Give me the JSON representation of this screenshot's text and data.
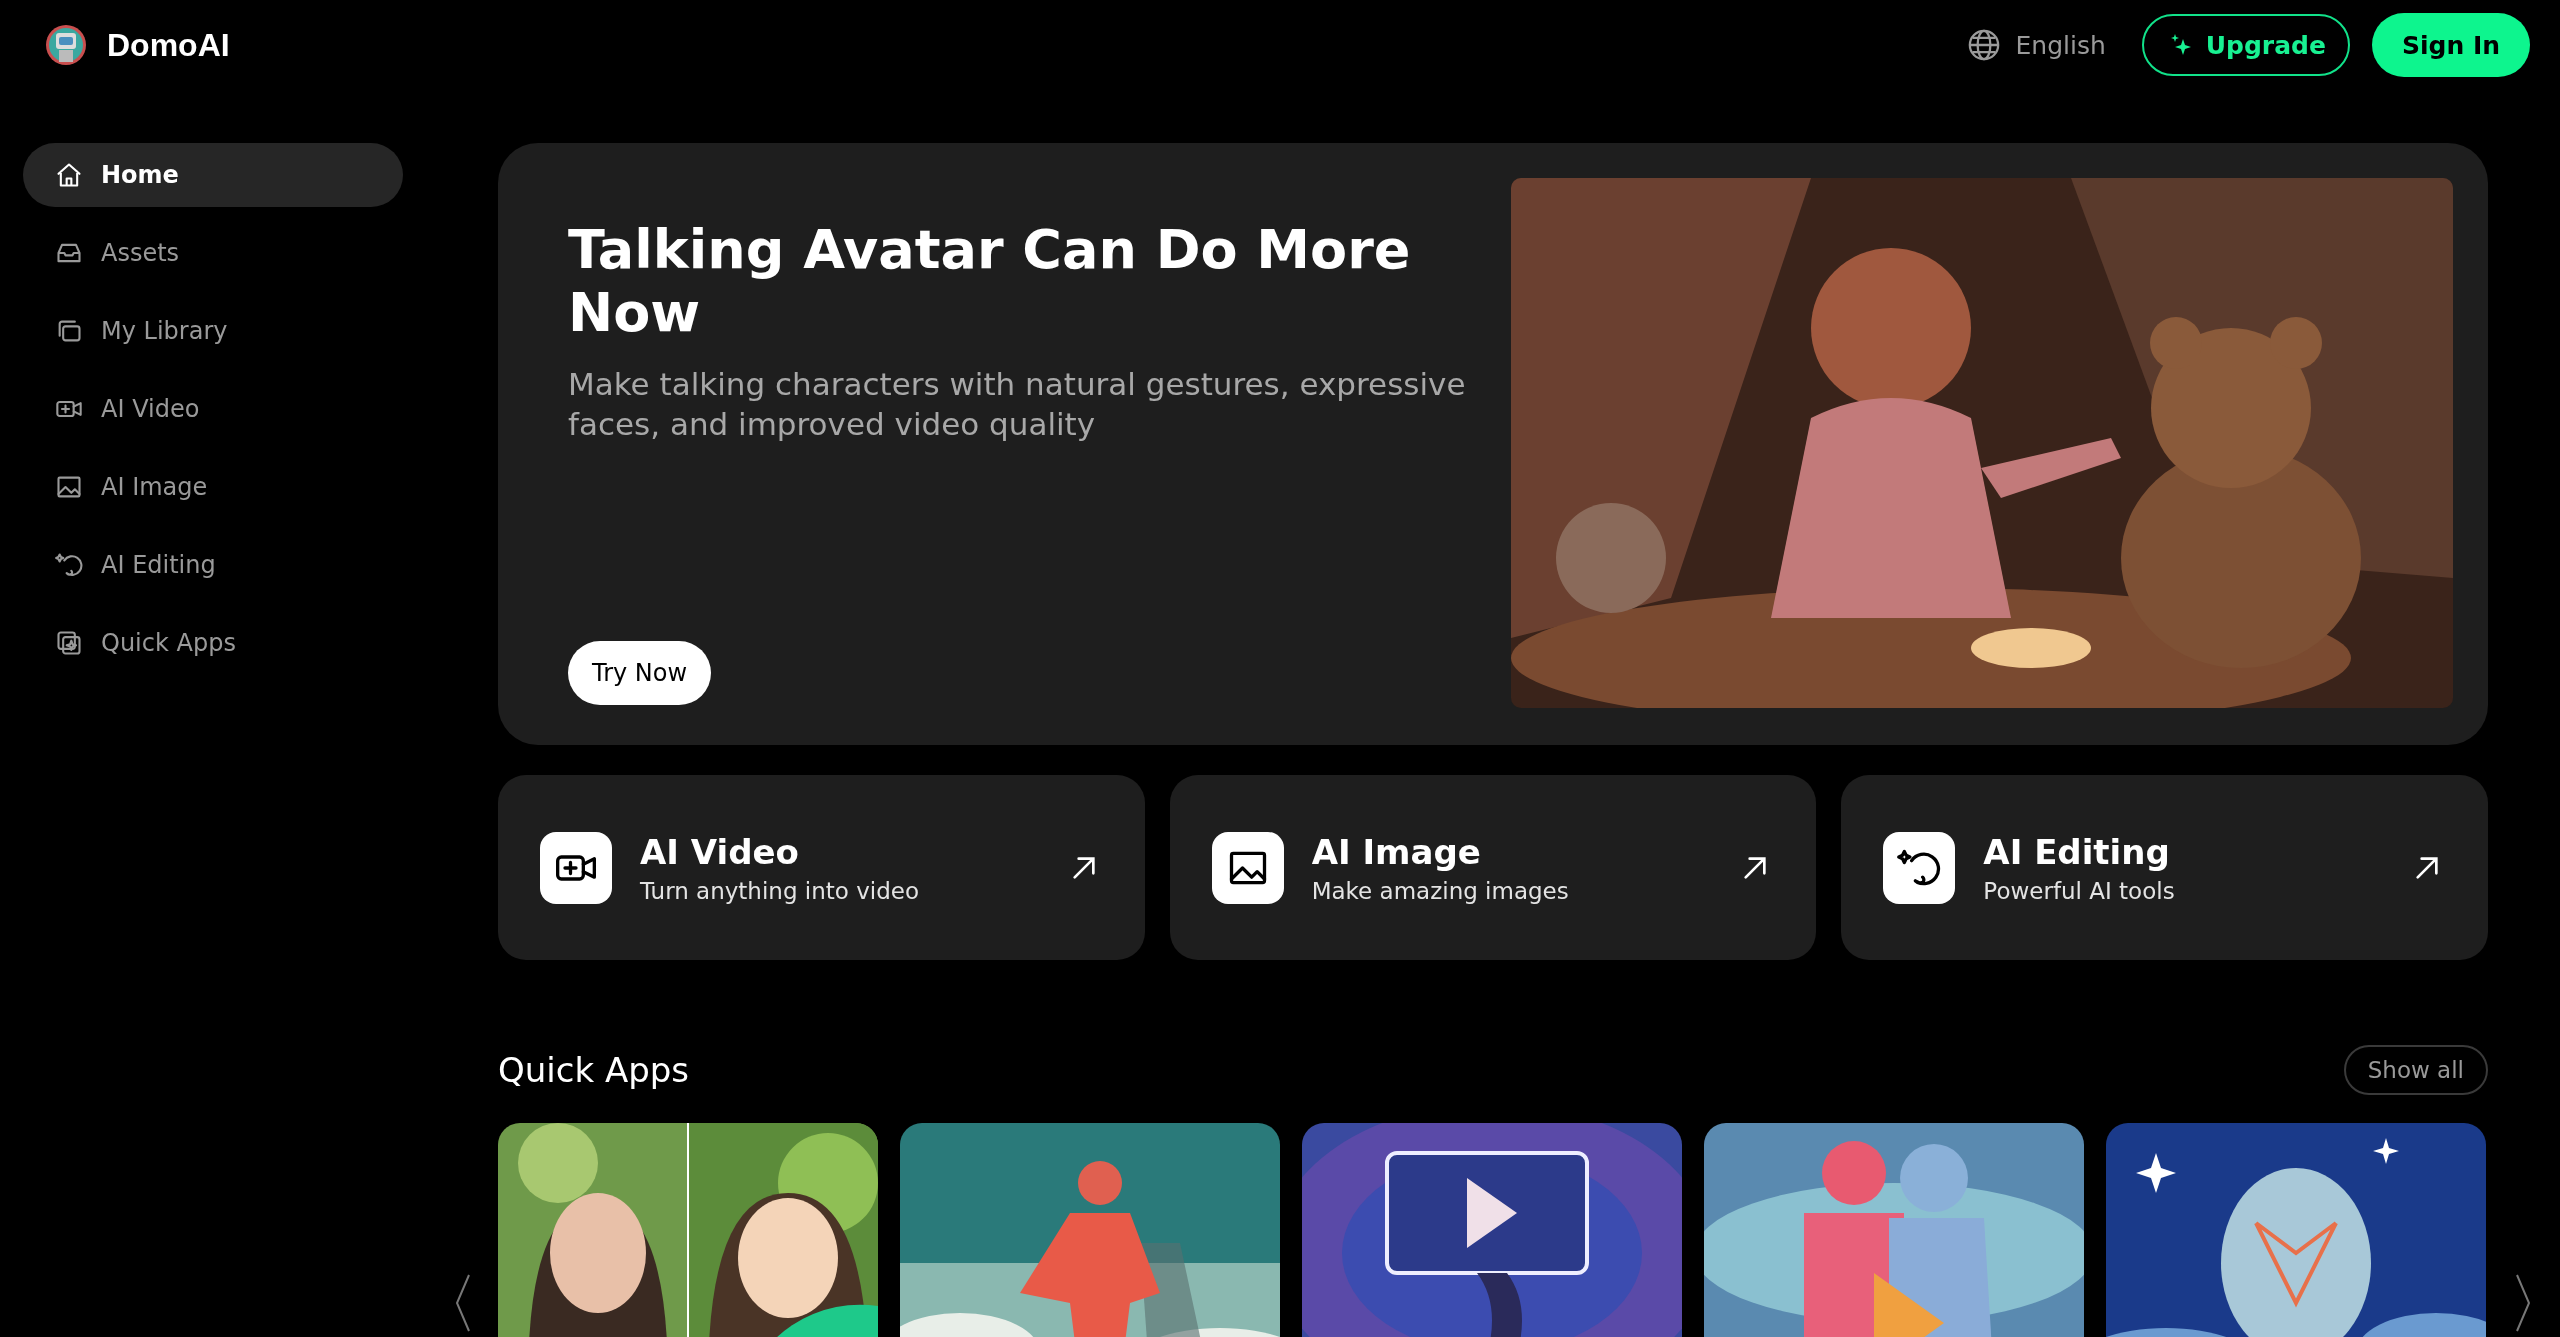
{
  "header": {
    "logo": "DomoAI",
    "language": "English",
    "upgrade": "Upgrade",
    "sign_in": "Sign In"
  },
  "sidebar": {
    "items": [
      {
        "label": "Home",
        "selected": true
      },
      {
        "label": "Assets",
        "selected": false
      },
      {
        "label": "My Library",
        "selected": false
      },
      {
        "label": "AI Video",
        "selected": false
      },
      {
        "label": "AI Image",
        "selected": false
      },
      {
        "label": "AI Editing",
        "selected": false
      },
      {
        "label": "Quick Apps",
        "selected": false
      }
    ]
  },
  "hero": {
    "title": "Talking Avatar Can Do More Now",
    "subtitle": "Make talking characters with natural gestures, expressive faces, and improved video quality",
    "button": "Try Now"
  },
  "features": [
    {
      "title": "AI Video",
      "subtitle": "Turn anything into video"
    },
    {
      "title": "AI Image",
      "subtitle": "Make amazing images"
    },
    {
      "title": "AI Editing",
      "subtitle": "Powerful AI tools"
    }
  ],
  "quick_apps": {
    "title": "Quick Apps",
    "button": "Show all"
  }
}
